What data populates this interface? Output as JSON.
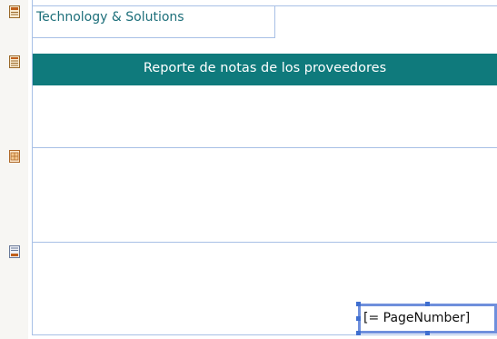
{
  "header": {
    "company_name": "Technology & Solutions",
    "report_title": "Reporte de notas de los proveedores"
  },
  "footer": {
    "page_number_field": "[= PageNumber]"
  },
  "band_icons": [
    "page-header-icon",
    "report-header-icon",
    "detail-icon",
    "page-footer-icon"
  ],
  "colors": {
    "title_bar": "#0f7a7c",
    "company_text": "#1d6f7a",
    "guide_lines": "#a8c0e6",
    "selection": "#6f8fdc"
  }
}
